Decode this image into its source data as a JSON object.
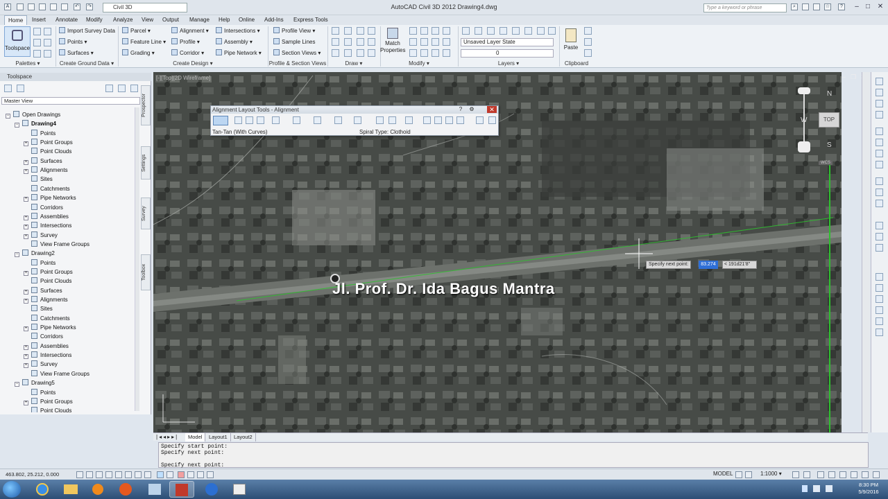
{
  "titlebar": {
    "workspace": "Civil 3D",
    "app_title": "AutoCAD Civil 3D 2012   Drawing4.dwg",
    "search_placeholder": "Type a keyword or phrase"
  },
  "menu_tabs": [
    "Home",
    "Insert",
    "Annotate",
    "Modify",
    "Analyze",
    "View",
    "Output",
    "Manage",
    "Help",
    "Online",
    "Add-Ins",
    "Express Tools"
  ],
  "ribbon": {
    "toolspace_label": "Toolspace",
    "create_ground_data": [
      "Import Survey Data",
      "Points",
      "Surfaces"
    ],
    "create_design": [
      "Parcel",
      "Feature Line",
      "Grading",
      "Alignment",
      "Profile",
      "Corridor",
      "Intersections",
      "Assembly",
      "Pipe Network"
    ],
    "profile_section": [
      "Profile View",
      "Sample Lines",
      "Section Views"
    ],
    "match_properties": "Match Properties",
    "layer_state": "Unsaved Layer State",
    "layer_value": "0",
    "paste": "Paste",
    "panels": [
      "Palettes",
      "Create Ground Data",
      "Create Design",
      "Profile & Section Views",
      "Draw",
      "Modify",
      "Layers",
      "Clipboard"
    ]
  },
  "toolspace": {
    "title": "Toolspace",
    "view": "Master View",
    "tree": [
      {
        "label": "Open Drawings",
        "level": 0,
        "bold": false
      },
      {
        "label": "Drawing4",
        "level": 1,
        "bold": true
      },
      {
        "label": "Points",
        "level": 2
      },
      {
        "label": "Point Groups",
        "level": 2
      },
      {
        "label": "Point Clouds",
        "level": 2
      },
      {
        "label": "Surfaces",
        "level": 2
      },
      {
        "label": "Alignments",
        "level": 2
      },
      {
        "label": "Sites",
        "level": 2
      },
      {
        "label": "Catchments",
        "level": 2
      },
      {
        "label": "Pipe Networks",
        "level": 2
      },
      {
        "label": "Corridors",
        "level": 2
      },
      {
        "label": "Assemblies",
        "level": 2
      },
      {
        "label": "Intersections",
        "level": 2
      },
      {
        "label": "Survey",
        "level": 2
      },
      {
        "label": "View Frame Groups",
        "level": 2
      },
      {
        "label": "Drawing2",
        "level": 1
      },
      {
        "label": "Points",
        "level": 2
      },
      {
        "label": "Point Groups",
        "level": 2
      },
      {
        "label": "Point Clouds",
        "level": 2
      },
      {
        "label": "Surfaces",
        "level": 2
      },
      {
        "label": "Alignments",
        "level": 2
      },
      {
        "label": "Sites",
        "level": 2
      },
      {
        "label": "Catchments",
        "level": 2
      },
      {
        "label": "Pipe Networks",
        "level": 2
      },
      {
        "label": "Corridors",
        "level": 2
      },
      {
        "label": "Assemblies",
        "level": 2
      },
      {
        "label": "Intersections",
        "level": 2
      },
      {
        "label": "Survey",
        "level": 2
      },
      {
        "label": "View Frame Groups",
        "level": 2
      },
      {
        "label": "Drawing5",
        "level": 1
      },
      {
        "label": "Points",
        "level": 2
      },
      {
        "label": "Point Groups",
        "level": 2
      },
      {
        "label": "Point Clouds",
        "level": 2
      }
    ],
    "side_tabs": [
      "Prospector",
      "Settings",
      "Survey",
      "Toolbox"
    ]
  },
  "viewport": {
    "label": "[-][Top][2D Wireframe]",
    "road_label": "Jl. Prof. Dr. Ida Bagus Mantra",
    "prompt": "Specify next point:",
    "dyn_value": "83.274",
    "angle_value": "< 191d21'8\""
  },
  "align_toolbar": {
    "title": "Alignment Layout Tools - Alignment",
    "left_status": "Tan-Tan (With Curves)",
    "right_status": "Spiral Type: Clothoid"
  },
  "viewcube": {
    "north": "N",
    "south": "S",
    "west": "W",
    "top": "TOP",
    "wcs": "WCS"
  },
  "layout_tabs": [
    "Model",
    "Layout1",
    "Layout2"
  ],
  "command_lines": [
    "Specify start point:",
    "Specify next point:",
    "",
    "Specify next point:"
  ],
  "statusbar": {
    "coords": "463.802, 25.212, 0.000",
    "model": "MODEL",
    "scale": "1:1000"
  },
  "clock": {
    "time": "8:30 PM",
    "date": "5/9/2016"
  }
}
